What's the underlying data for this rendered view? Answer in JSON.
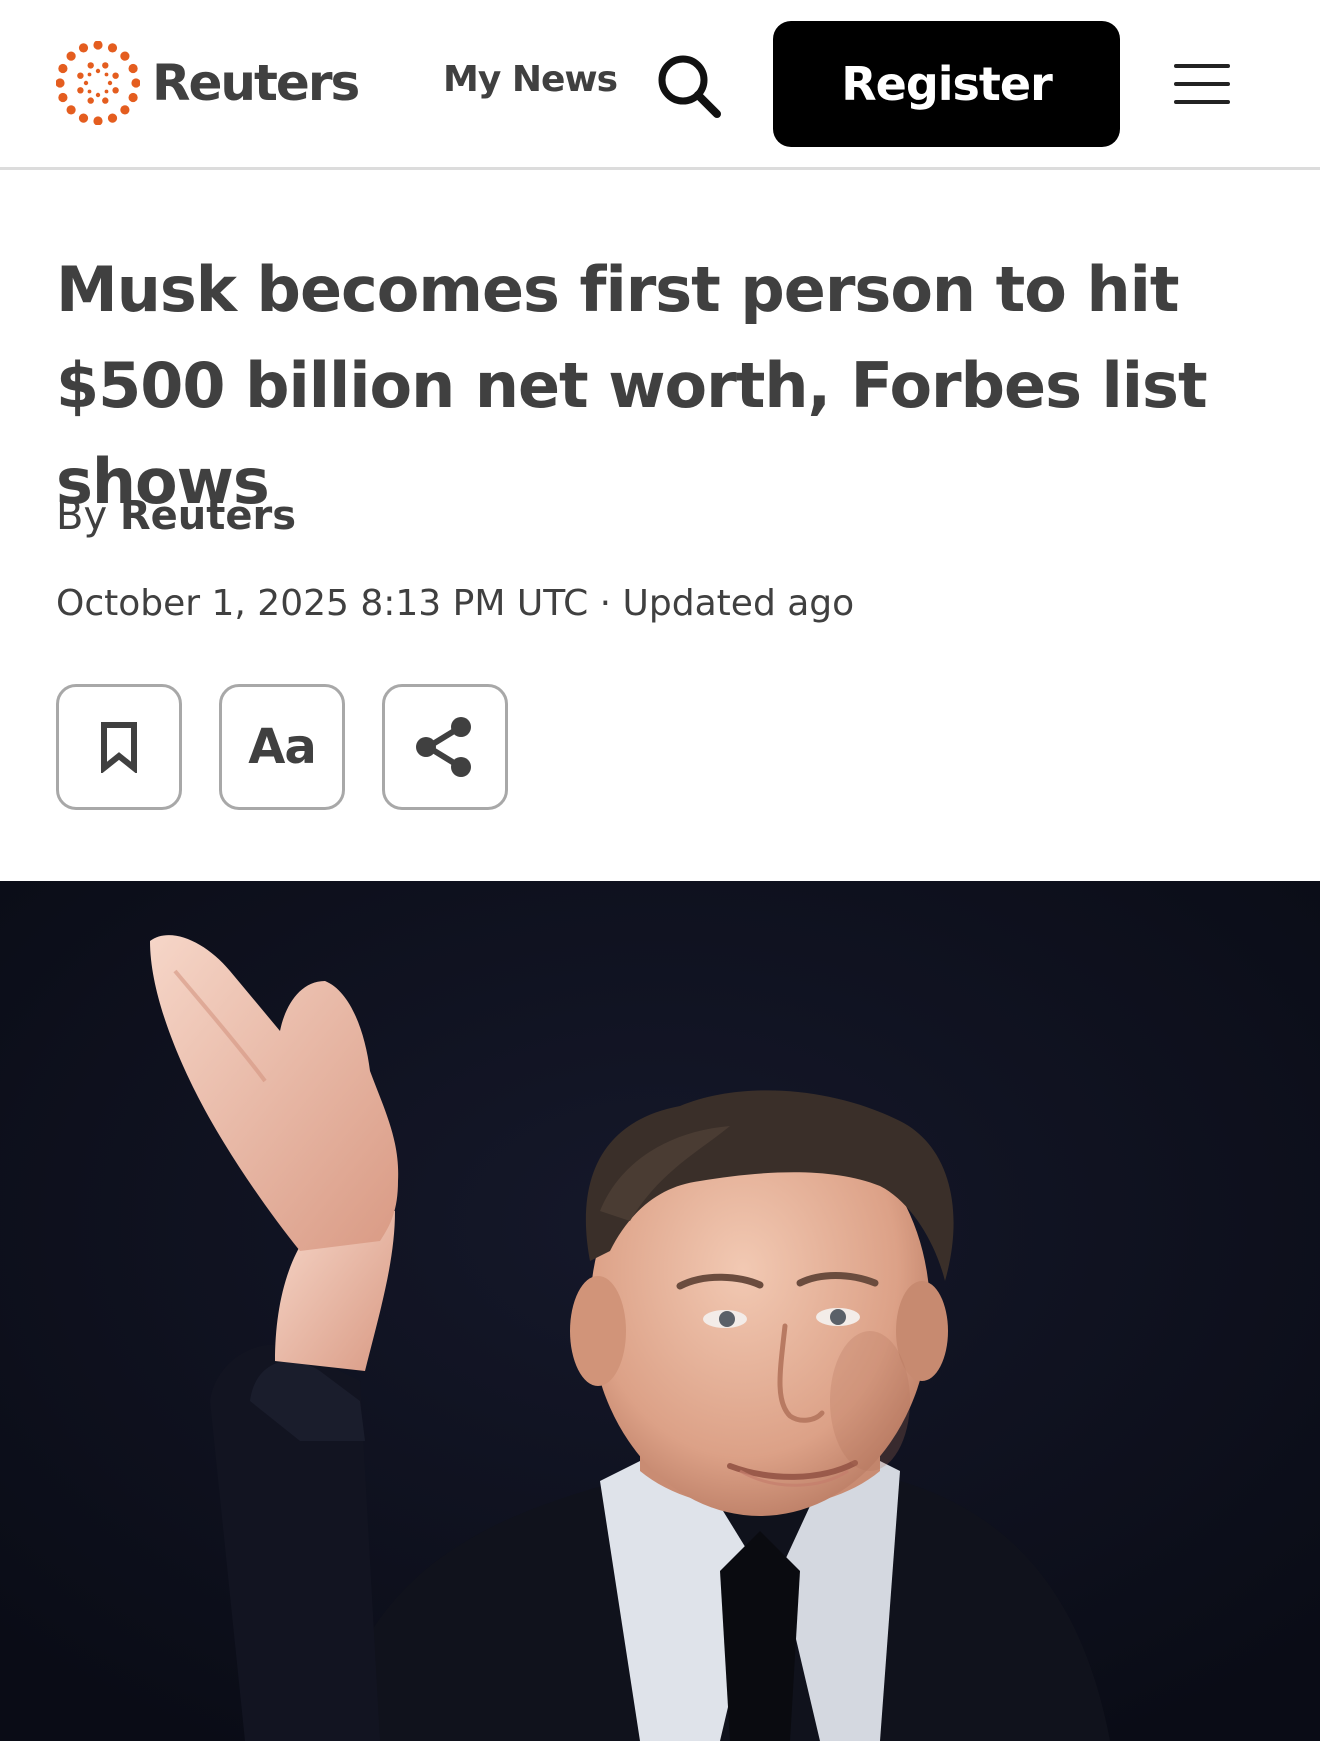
{
  "header": {
    "logo_text": "Reuters",
    "my_news_label": "My News",
    "register_label": "Register",
    "search_icon": "search-icon",
    "menu_icon": "hamburger-menu-icon"
  },
  "article": {
    "headline": "Musk becomes first person to hit $500 billion net worth, Forbes list shows",
    "byline_prefix": "By",
    "byline_author": "Reuters",
    "dateline": "October 1, 2025 8:13 PM UTC · Updated ago",
    "tools": {
      "bookmark_icon": "bookmark-icon",
      "text_size_label": "Aa",
      "share_icon": "share-icon"
    }
  },
  "colors": {
    "logo_orange": "#e45d1f",
    "text": "#404040",
    "register_bg": "#000000",
    "hero_bg": "#0d0f1a"
  }
}
